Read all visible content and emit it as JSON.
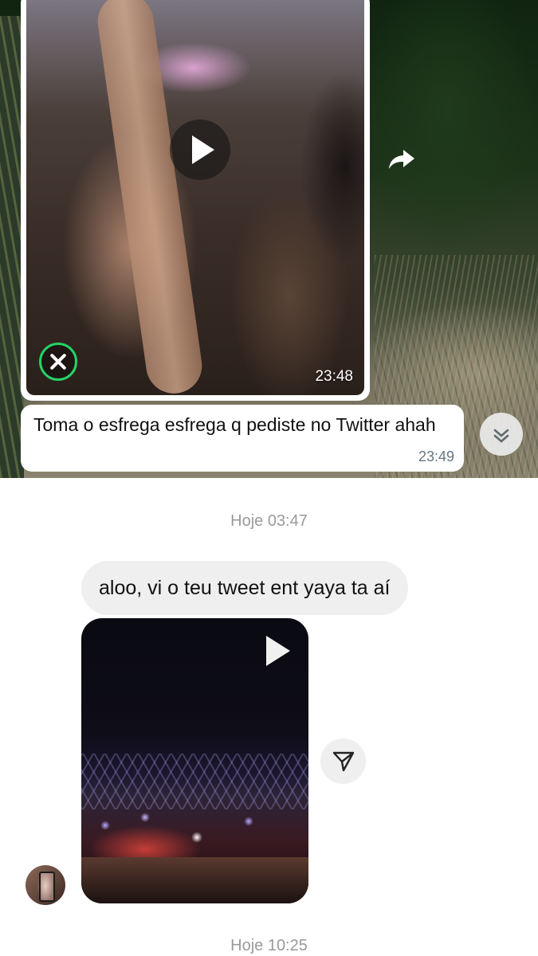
{
  "whatsapp": {
    "video": {
      "time": "23:48"
    },
    "message": {
      "text": "Toma o esfrega esfrega q pediste no Twitter ahah",
      "time": "23:49"
    }
  },
  "instagram": {
    "date_separator_1": "Hoje 03:47",
    "message": "aloo, vi o teu tweet ent yaya ta aí",
    "date_separator_2": "Hoje 10:25"
  },
  "icons": {
    "video_play": "play-icon",
    "cancel_download": "close-icon",
    "forward": "forward-arrow-icon",
    "scroll_down": "double-chevron-down-icon",
    "share": "paper-plane-icon",
    "avatar": "profile-avatar"
  },
  "colors": {
    "whatsapp_accent": "#25d366",
    "timestamp": "#667781",
    "ig_bubble": "#efefef",
    "separator_text": "#9a9a9a"
  }
}
